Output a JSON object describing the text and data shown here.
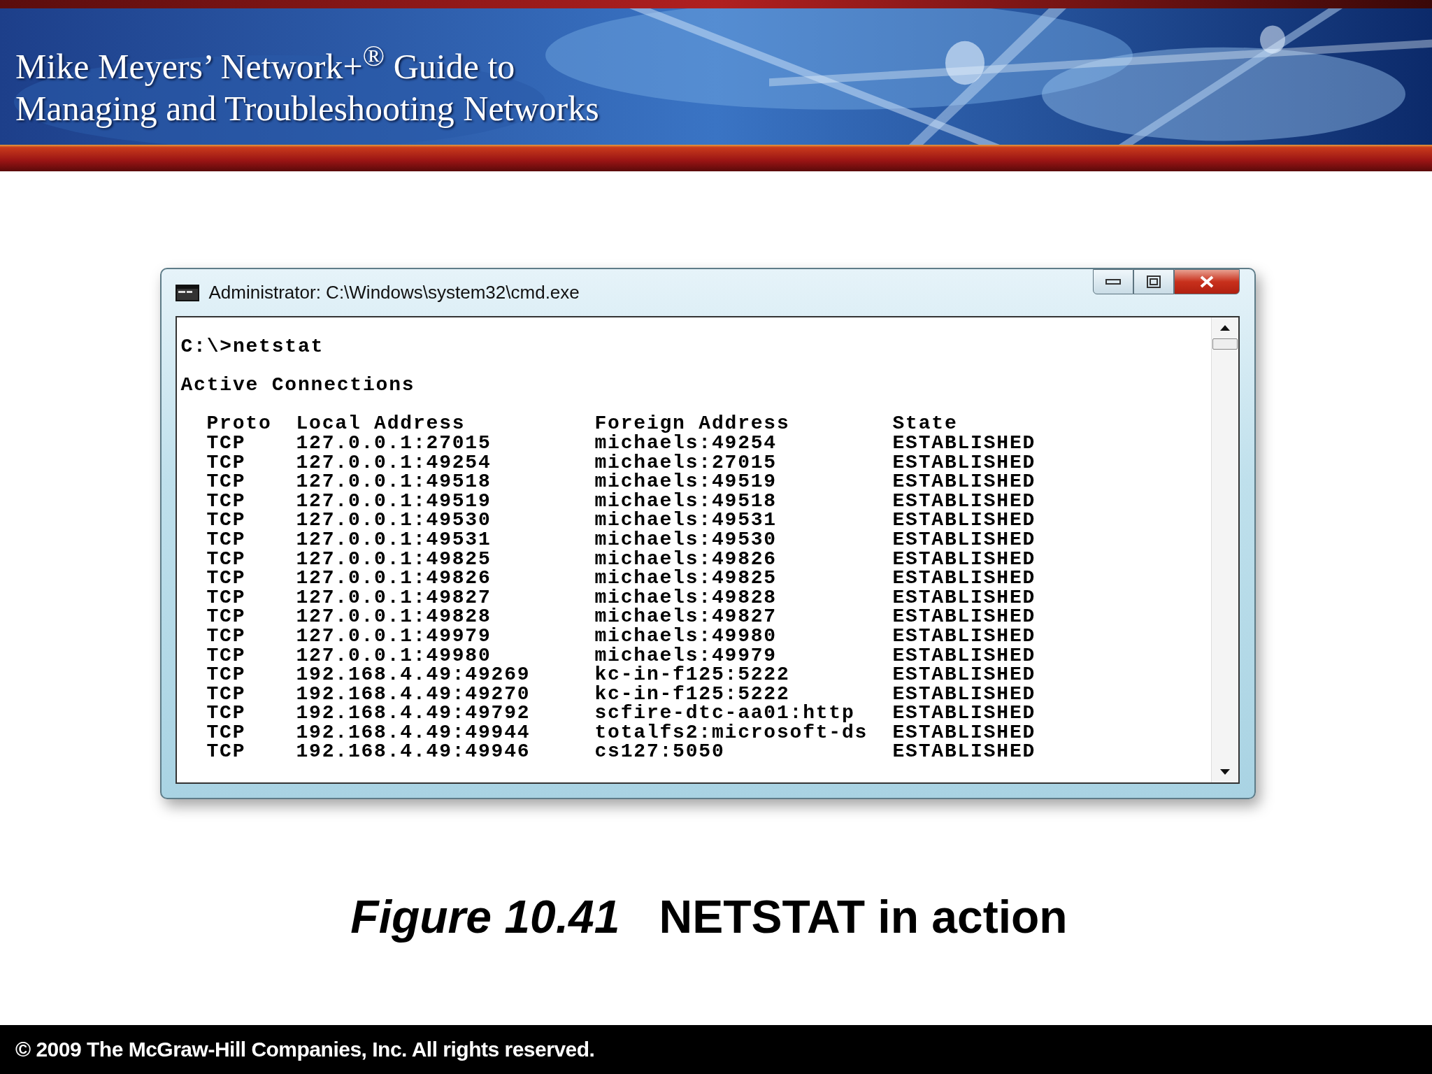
{
  "header": {
    "title_lines": [
      "Mike Meyers’ Network+$^{®}$ Guide to",
      "Managing and Troubleshooting Networks"
    ]
  },
  "window": {
    "title": "Administrator: C:\\Windows\\system32\\cmd.exe",
    "command": "C:\\>netstat",
    "heading": "Active Connections",
    "columns": [
      "Proto",
      "Local Address",
      "Foreign Address",
      "State"
    ],
    "rows": [
      [
        "TCP",
        "127.0.0.1:27015",
        "michaels:49254",
        "ESTABLISHED"
      ],
      [
        "TCP",
        "127.0.0.1:49254",
        "michaels:27015",
        "ESTABLISHED"
      ],
      [
        "TCP",
        "127.0.0.1:49518",
        "michaels:49519",
        "ESTABLISHED"
      ],
      [
        "TCP",
        "127.0.0.1:49519",
        "michaels:49518",
        "ESTABLISHED"
      ],
      [
        "TCP",
        "127.0.0.1:49530",
        "michaels:49531",
        "ESTABLISHED"
      ],
      [
        "TCP",
        "127.0.0.1:49531",
        "michaels:49530",
        "ESTABLISHED"
      ],
      [
        "TCP",
        "127.0.0.1:49825",
        "michaels:49826",
        "ESTABLISHED"
      ],
      [
        "TCP",
        "127.0.0.1:49826",
        "michaels:49825",
        "ESTABLISHED"
      ],
      [
        "TCP",
        "127.0.0.1:49827",
        "michaels:49828",
        "ESTABLISHED"
      ],
      [
        "TCP",
        "127.0.0.1:49828",
        "michaels:49827",
        "ESTABLISHED"
      ],
      [
        "TCP",
        "127.0.0.1:49979",
        "michaels:49980",
        "ESTABLISHED"
      ],
      [
        "TCP",
        "127.0.0.1:49980",
        "michaels:49979",
        "ESTABLISHED"
      ],
      [
        "TCP",
        "192.168.4.49:49269",
        "kc-in-f125:5222",
        "ESTABLISHED"
      ],
      [
        "TCP",
        "192.168.4.49:49270",
        "kc-in-f125:5222",
        "ESTABLISHED"
      ],
      [
        "TCP",
        "192.168.4.49:49792",
        "scfire-dtc-aa01:http",
        "ESTABLISHED"
      ],
      [
        "TCP",
        "192.168.4.49:49944",
        "totalfs2:microsoft-ds",
        "ESTABLISHED"
      ],
      [
        "TCP",
        "192.168.4.49:49946",
        "cs127:5050",
        "ESTABLISHED"
      ]
    ]
  },
  "caption": {
    "label": "Figure 10.41",
    "text": "NETSTAT in action"
  },
  "footer": "© 2009 The McGraw-Hill Companies, Inc. All rights reserved."
}
